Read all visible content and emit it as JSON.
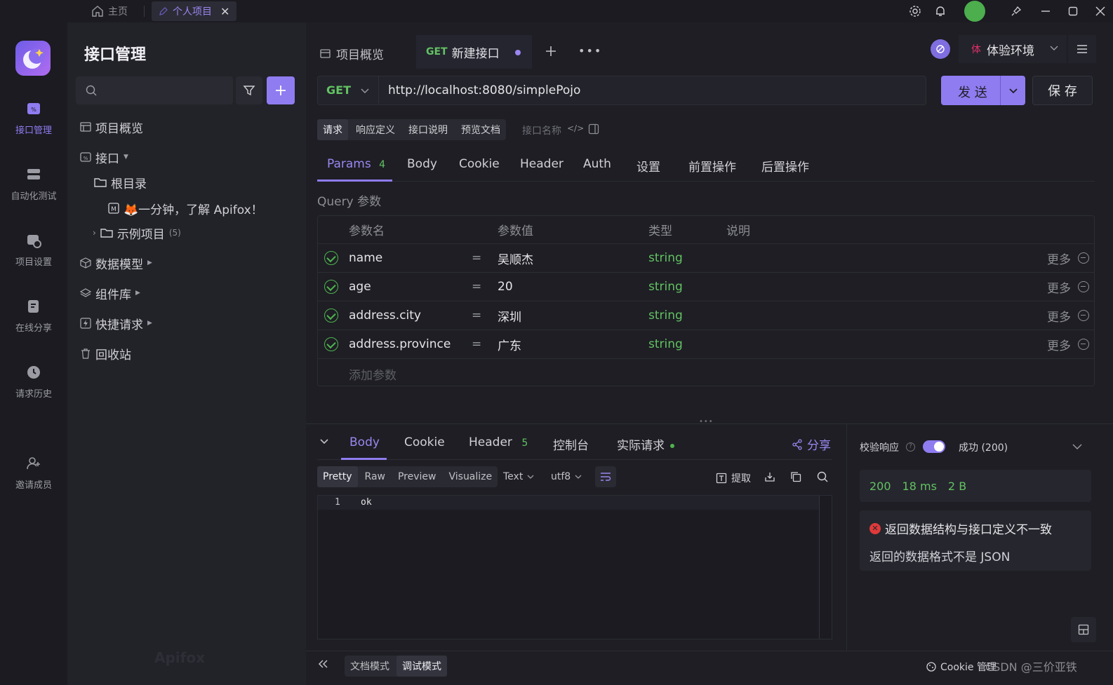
{
  "titlebar": {
    "tabs": [
      {
        "label": "主页",
        "icon": "home-icon"
      },
      {
        "label": "个人项目",
        "icon": "edit-icon"
      }
    ]
  },
  "rail": {
    "items": [
      {
        "label": "接口管理",
        "icon": "api-icon",
        "active": true
      },
      {
        "label": "自动化测试",
        "icon": "automation-icon"
      },
      {
        "label": "项目设置",
        "icon": "project-settings-icon"
      },
      {
        "label": "在线分享",
        "icon": "share-doc-icon"
      },
      {
        "label": "请求历史",
        "icon": "history-icon"
      },
      {
        "label": "邀请成员",
        "icon": "invite-member-icon"
      }
    ]
  },
  "tree": {
    "title": "接口管理",
    "search_placeholder": "",
    "items": [
      {
        "label": "项目概览",
        "icon": "overview-icon"
      },
      {
        "label": "接口",
        "icon": "api-folder-icon"
      },
      {
        "label": "根目录",
        "icon": "folder-icon"
      },
      {
        "label": "🦊一分钟，了解 Apifox！",
        "icon": "markdown-icon"
      },
      {
        "label": "示例项目",
        "count": "(5)",
        "icon": "folder-icon"
      },
      {
        "label": "数据模型",
        "icon": "cube-icon"
      },
      {
        "label": "组件库",
        "icon": "layers-icon"
      },
      {
        "label": "快捷请求",
        "icon": "quick-request-icon"
      },
      {
        "label": "回收站",
        "icon": "trash-icon"
      }
    ],
    "watermark": "Apifox"
  },
  "main": {
    "tabs": [
      {
        "label": "项目概览"
      },
      {
        "method": "GET",
        "label": "新建接口"
      }
    ],
    "env_badge": "体",
    "env_label": "体验环境",
    "method": "GET",
    "url": "http://localhost:8080/simplePojo",
    "send_label": "发 送",
    "save_label": "保 存",
    "mode_tabs": [
      "请求",
      "响应定义",
      "接口说明",
      "预览文档"
    ],
    "name_placeholder": "接口名称",
    "param_tabs": [
      {
        "label": "Params",
        "badge": "4"
      },
      {
        "label": "Body"
      },
      {
        "label": "Cookie"
      },
      {
        "label": "Header"
      },
      {
        "label": "Auth"
      },
      {
        "label": "设置"
      },
      {
        "label": "前置操作"
      },
      {
        "label": "后置操作"
      }
    ],
    "query_title": "Query 参数",
    "columns": [
      "参数名",
      "参数值",
      "类型",
      "说明"
    ],
    "params": [
      {
        "name": "name",
        "eq": "=",
        "value": "吴顺杰",
        "type": "string",
        "more": "更多"
      },
      {
        "name": "age",
        "eq": "=",
        "value": "20",
        "type": "string",
        "more": "更多"
      },
      {
        "name": "address.city",
        "eq": "=",
        "value": "深圳",
        "type": "string",
        "more": "更多"
      },
      {
        "name": "address.province",
        "eq": "=",
        "value": "广东",
        "type": "string",
        "more": "更多"
      }
    ],
    "add_param": "添加参数"
  },
  "response": {
    "tabs": [
      {
        "label": "Body"
      },
      {
        "label": "Cookie"
      },
      {
        "label": "Header",
        "badge": "5"
      },
      {
        "label": "控制台"
      },
      {
        "label": "实际请求"
      }
    ],
    "share_label": "分享",
    "formats": [
      "Pretty",
      "Raw",
      "Preview",
      "Visualize"
    ],
    "text_select": "Text",
    "encoding_select": "utf8",
    "extract_label": "提取",
    "line_number": "1",
    "body": "ok",
    "validate_label": "校验响应",
    "status_select": "成功 (200)",
    "status_code": "200",
    "time": "18 ms",
    "size": "2 B",
    "error_title": "返回数据结构与接口定义不一致",
    "error_detail": "返回的数据格式不是 JSON"
  },
  "footer": {
    "doc_mode": "文档模式",
    "debug_mode": "调试模式",
    "cookie_manager": "Cookie 管理",
    "watermark": "CSDN @三价亚铁"
  },
  "colors": {
    "accent": "#8f7cf0",
    "success": "#4fb34f",
    "error": "#e03a3a"
  }
}
